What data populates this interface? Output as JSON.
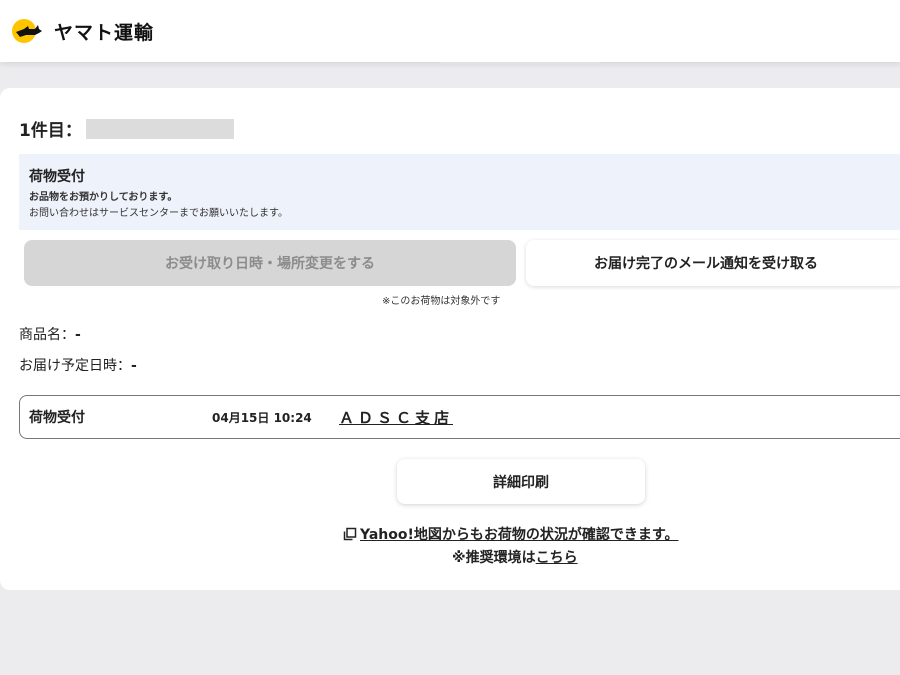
{
  "header": {
    "brand": "ヤマト運輸",
    "brand_color": "#ffc400"
  },
  "item": {
    "label": "1件目："
  },
  "status": {
    "title": "荷物受付",
    "line1": "お品物をお預かりしております。",
    "line2": "お問い合わせはサービスセンターまでお願いいたします。"
  },
  "buttons": {
    "change_label": "お受け取り日時・場所変更をする",
    "mail_label": "お届け完了のメール通知を受け取る",
    "not_applicable_note": "※このお荷物は対象外です",
    "print_label": "詳細印刷"
  },
  "details": {
    "product_label": "商品名：",
    "product_value": "-",
    "delivery_label": "お届け予定日時：",
    "delivery_value": "-"
  },
  "tracking": {
    "status": "荷物受付",
    "datetime": "04月15日 10:24",
    "branch": "ＡＤＳＣ支店"
  },
  "links": {
    "yahoo": "Yahoo!地図からもお荷物の状況が確認できます。",
    "recommend_prefix": "※推奨環境は",
    "recommend_link": "こちら"
  }
}
